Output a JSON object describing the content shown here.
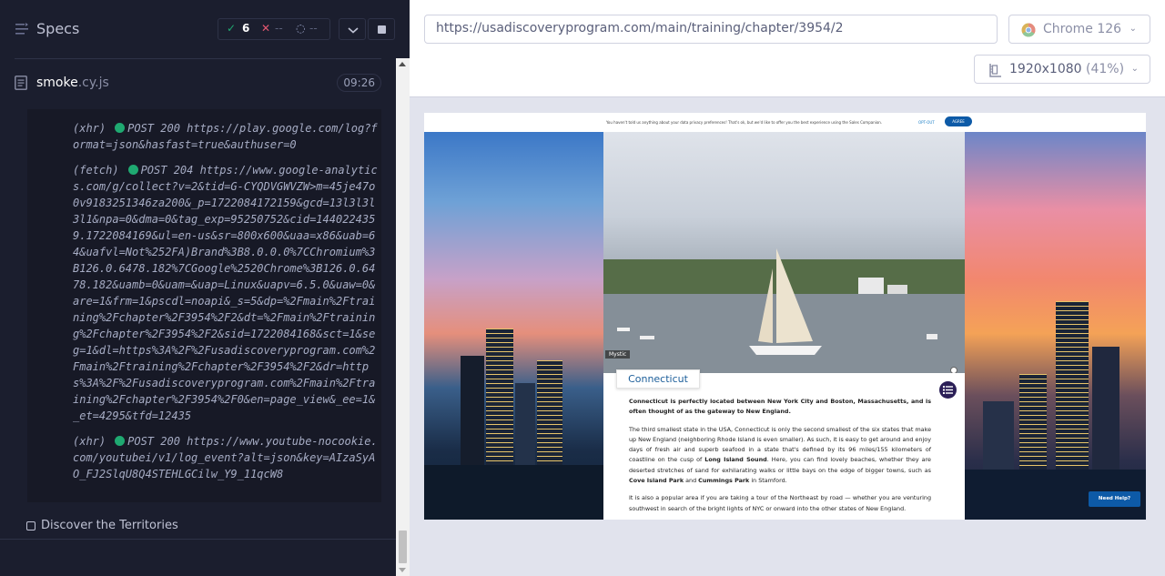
{
  "runner": {
    "specs_title": "Specs",
    "stats": {
      "passed": "6",
      "failed": "--",
      "pending": "--"
    },
    "file": {
      "name": "smoke",
      "ext": ".cy.js",
      "time": "09:26"
    },
    "log": [
      {
        "kind": "(xhr)",
        "text": "POST 200 https://play.google.com/log?format=json&hasfast=true&authuser=0"
      },
      {
        "kind": "(fetch)",
        "text": "POST 204 https://www.google-analytics.com/g/collect?v=2&tid=G-CYQDVGWVZW>m=45je47o0v9183251346za200&_p=1722084172159&gcd=13l3l3l3l1&npa=0&dma=0&tag_exp=95250752&cid=1440224359.1722084169&ul=en-us&sr=800x600&uaa=x86&uab=64&uafvl=Not%252FA)Brand%3B8.0.0.0%7CChromium%3B126.0.6478.182%7CGoogle%2520Chrome%3B126.0.6478.182&uamb=0&uam=&uap=Linux&uapv=6.5.0&uaw=0&are=1&frm=1&pscdl=noapi&_s=5&dp=%2Fmain%2Ftraining%2Fchapter%2F3954%2F2&dt=%2Fmain%2Ftraining%2Fchapter%2F3954%2F2&sid=1722084168&sct=1&seg=1&dl=https%3A%2F%2Fusadiscoveryprogram.com%2Fmain%2Ftraining%2Fchapter%2F3954%2F2&dr=https%3A%2F%2Fusadiscoveryprogram.com%2Fmain%2Ftraining%2Fchapter%2F3954%2F0&en=page_view&_ee=1&_et=4295&tfd=12435"
      },
      {
        "kind": "(xhr)",
        "text": "POST 200 https://www.youtube-nocookie.com/youtubei/v1/log_event?alt=json&key=AIzaSyAO_FJ2SlqU8Q4STEHLGCilw_Y9_11qcW8"
      }
    ],
    "next_test": "Discover the Territories"
  },
  "browser": {
    "url": "https://usadiscoveryprogram.com/main/training/chapter/3954/2",
    "name": "Chrome 126",
    "viewport": "1920x1080",
    "zoom": "(41%)"
  },
  "app": {
    "cookie_text": "You haven't told us anything about your data privacy preferences! That's ok, but we'd like to offer you the best experience using the Sales Companion.",
    "cookie_optout": "OPT-OUT",
    "cookie_agree": "AGREE",
    "photo_caption": "Mystic",
    "state_title": "Connecticut",
    "lead": "Connecticut is perfectly located between New York City and Boston, Massachusetts, and is often thought of as the gateway to New England.",
    "p1_a": "The third smallest state in the USA, Connecticut is only the second smallest of the six states that make up New England (neighboring Rhode Island is even smaller). As such, it is easy to get around and enjoy days of fresh air and superb seafood in a state that's defined by its 96 miles/155 kilometers of coastline on the cusp of ",
    "p1_b": "Long Island Sound",
    "p1_c": ". Here, you can find lovely beaches, whether they are deserted stretches of sand for exhilarating walks or little bays on the edge of bigger towns, such as ",
    "p1_d": "Cove Island Park",
    "p1_e": " and ",
    "p1_f": "Cummings Park",
    "p1_g": " in Stamford.",
    "p2": "It is also a popular area if you are taking a tour of the Northeast by road — whether you are venturing southwest in search of the bright lights of NYC or onward into the other states of New England.",
    "need_help": "Need Help?"
  }
}
